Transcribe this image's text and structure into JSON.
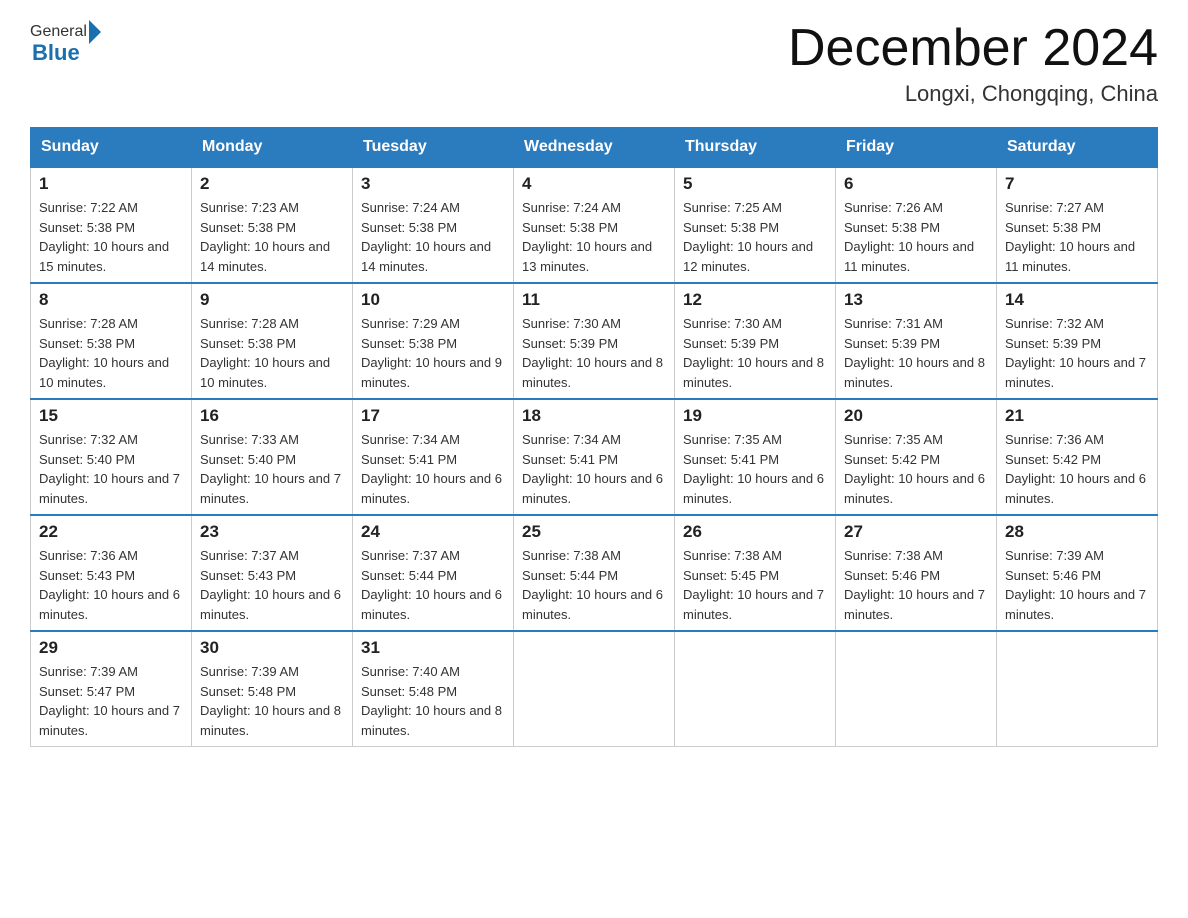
{
  "header": {
    "logo": {
      "general": "General",
      "blue": "Blue"
    },
    "title": "December 2024",
    "location": "Longxi, Chongqing, China"
  },
  "days_of_week": [
    "Sunday",
    "Monday",
    "Tuesday",
    "Wednesday",
    "Thursday",
    "Friday",
    "Saturday"
  ],
  "weeks": [
    [
      {
        "day": "1",
        "sunrise": "Sunrise: 7:22 AM",
        "sunset": "Sunset: 5:38 PM",
        "daylight": "Daylight: 10 hours and 15 minutes."
      },
      {
        "day": "2",
        "sunrise": "Sunrise: 7:23 AM",
        "sunset": "Sunset: 5:38 PM",
        "daylight": "Daylight: 10 hours and 14 minutes."
      },
      {
        "day": "3",
        "sunrise": "Sunrise: 7:24 AM",
        "sunset": "Sunset: 5:38 PM",
        "daylight": "Daylight: 10 hours and 14 minutes."
      },
      {
        "day": "4",
        "sunrise": "Sunrise: 7:24 AM",
        "sunset": "Sunset: 5:38 PM",
        "daylight": "Daylight: 10 hours and 13 minutes."
      },
      {
        "day": "5",
        "sunrise": "Sunrise: 7:25 AM",
        "sunset": "Sunset: 5:38 PM",
        "daylight": "Daylight: 10 hours and 12 minutes."
      },
      {
        "day": "6",
        "sunrise": "Sunrise: 7:26 AM",
        "sunset": "Sunset: 5:38 PM",
        "daylight": "Daylight: 10 hours and 11 minutes."
      },
      {
        "day": "7",
        "sunrise": "Sunrise: 7:27 AM",
        "sunset": "Sunset: 5:38 PM",
        "daylight": "Daylight: 10 hours and 11 minutes."
      }
    ],
    [
      {
        "day": "8",
        "sunrise": "Sunrise: 7:28 AM",
        "sunset": "Sunset: 5:38 PM",
        "daylight": "Daylight: 10 hours and 10 minutes."
      },
      {
        "day": "9",
        "sunrise": "Sunrise: 7:28 AM",
        "sunset": "Sunset: 5:38 PM",
        "daylight": "Daylight: 10 hours and 10 minutes."
      },
      {
        "day": "10",
        "sunrise": "Sunrise: 7:29 AM",
        "sunset": "Sunset: 5:38 PM",
        "daylight": "Daylight: 10 hours and 9 minutes."
      },
      {
        "day": "11",
        "sunrise": "Sunrise: 7:30 AM",
        "sunset": "Sunset: 5:39 PM",
        "daylight": "Daylight: 10 hours and 8 minutes."
      },
      {
        "day": "12",
        "sunrise": "Sunrise: 7:30 AM",
        "sunset": "Sunset: 5:39 PM",
        "daylight": "Daylight: 10 hours and 8 minutes."
      },
      {
        "day": "13",
        "sunrise": "Sunrise: 7:31 AM",
        "sunset": "Sunset: 5:39 PM",
        "daylight": "Daylight: 10 hours and 8 minutes."
      },
      {
        "day": "14",
        "sunrise": "Sunrise: 7:32 AM",
        "sunset": "Sunset: 5:39 PM",
        "daylight": "Daylight: 10 hours and 7 minutes."
      }
    ],
    [
      {
        "day": "15",
        "sunrise": "Sunrise: 7:32 AM",
        "sunset": "Sunset: 5:40 PM",
        "daylight": "Daylight: 10 hours and 7 minutes."
      },
      {
        "day": "16",
        "sunrise": "Sunrise: 7:33 AM",
        "sunset": "Sunset: 5:40 PM",
        "daylight": "Daylight: 10 hours and 7 minutes."
      },
      {
        "day": "17",
        "sunrise": "Sunrise: 7:34 AM",
        "sunset": "Sunset: 5:41 PM",
        "daylight": "Daylight: 10 hours and 6 minutes."
      },
      {
        "day": "18",
        "sunrise": "Sunrise: 7:34 AM",
        "sunset": "Sunset: 5:41 PM",
        "daylight": "Daylight: 10 hours and 6 minutes."
      },
      {
        "day": "19",
        "sunrise": "Sunrise: 7:35 AM",
        "sunset": "Sunset: 5:41 PM",
        "daylight": "Daylight: 10 hours and 6 minutes."
      },
      {
        "day": "20",
        "sunrise": "Sunrise: 7:35 AM",
        "sunset": "Sunset: 5:42 PM",
        "daylight": "Daylight: 10 hours and 6 minutes."
      },
      {
        "day": "21",
        "sunrise": "Sunrise: 7:36 AM",
        "sunset": "Sunset: 5:42 PM",
        "daylight": "Daylight: 10 hours and 6 minutes."
      }
    ],
    [
      {
        "day": "22",
        "sunrise": "Sunrise: 7:36 AM",
        "sunset": "Sunset: 5:43 PM",
        "daylight": "Daylight: 10 hours and 6 minutes."
      },
      {
        "day": "23",
        "sunrise": "Sunrise: 7:37 AM",
        "sunset": "Sunset: 5:43 PM",
        "daylight": "Daylight: 10 hours and 6 minutes."
      },
      {
        "day": "24",
        "sunrise": "Sunrise: 7:37 AM",
        "sunset": "Sunset: 5:44 PM",
        "daylight": "Daylight: 10 hours and 6 minutes."
      },
      {
        "day": "25",
        "sunrise": "Sunrise: 7:38 AM",
        "sunset": "Sunset: 5:44 PM",
        "daylight": "Daylight: 10 hours and 6 minutes."
      },
      {
        "day": "26",
        "sunrise": "Sunrise: 7:38 AM",
        "sunset": "Sunset: 5:45 PM",
        "daylight": "Daylight: 10 hours and 7 minutes."
      },
      {
        "day": "27",
        "sunrise": "Sunrise: 7:38 AM",
        "sunset": "Sunset: 5:46 PM",
        "daylight": "Daylight: 10 hours and 7 minutes."
      },
      {
        "day": "28",
        "sunrise": "Sunrise: 7:39 AM",
        "sunset": "Sunset: 5:46 PM",
        "daylight": "Daylight: 10 hours and 7 minutes."
      }
    ],
    [
      {
        "day": "29",
        "sunrise": "Sunrise: 7:39 AM",
        "sunset": "Sunset: 5:47 PM",
        "daylight": "Daylight: 10 hours and 7 minutes."
      },
      {
        "day": "30",
        "sunrise": "Sunrise: 7:39 AM",
        "sunset": "Sunset: 5:48 PM",
        "daylight": "Daylight: 10 hours and 8 minutes."
      },
      {
        "day": "31",
        "sunrise": "Sunrise: 7:40 AM",
        "sunset": "Sunset: 5:48 PM",
        "daylight": "Daylight: 10 hours and 8 minutes."
      },
      null,
      null,
      null,
      null
    ]
  ]
}
